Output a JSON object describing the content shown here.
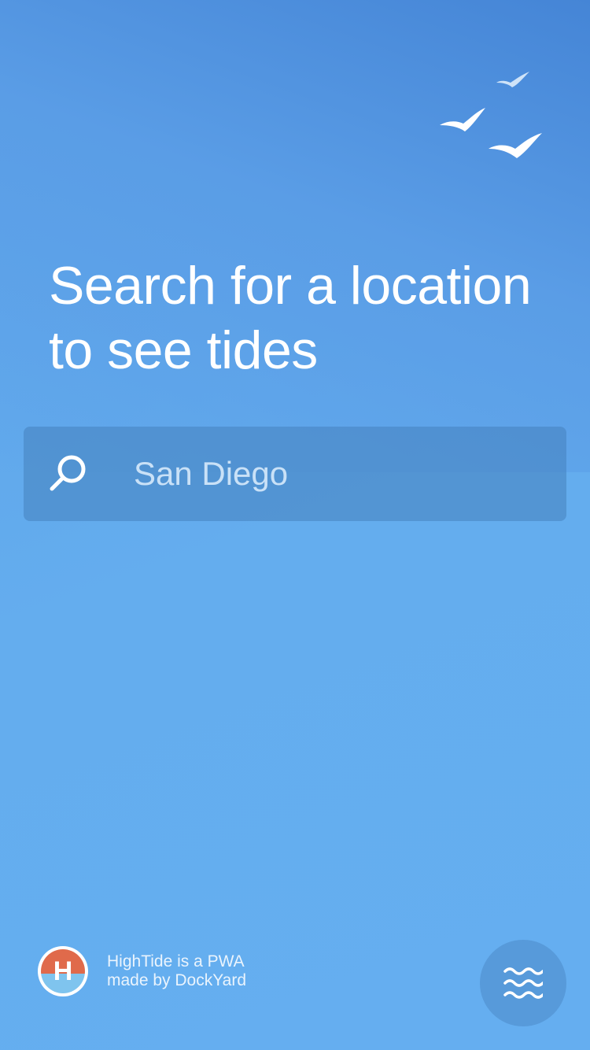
{
  "headline": "Search for a location to see tides",
  "search": {
    "value": "",
    "placeholder": "San Diego"
  },
  "footer": {
    "logo_letter": "H",
    "line1": "HighTide is a PWA",
    "line2": "made by DockYard"
  },
  "icons": {
    "birds": "birds-icon",
    "search": "search-icon",
    "logo": "hightide-logo-icon",
    "waves": "waves-icon"
  },
  "colors": {
    "background": "#64adee",
    "text": "#ffffff",
    "logo_top": "#e06a4b",
    "logo_bottom": "#7fc4ee"
  }
}
